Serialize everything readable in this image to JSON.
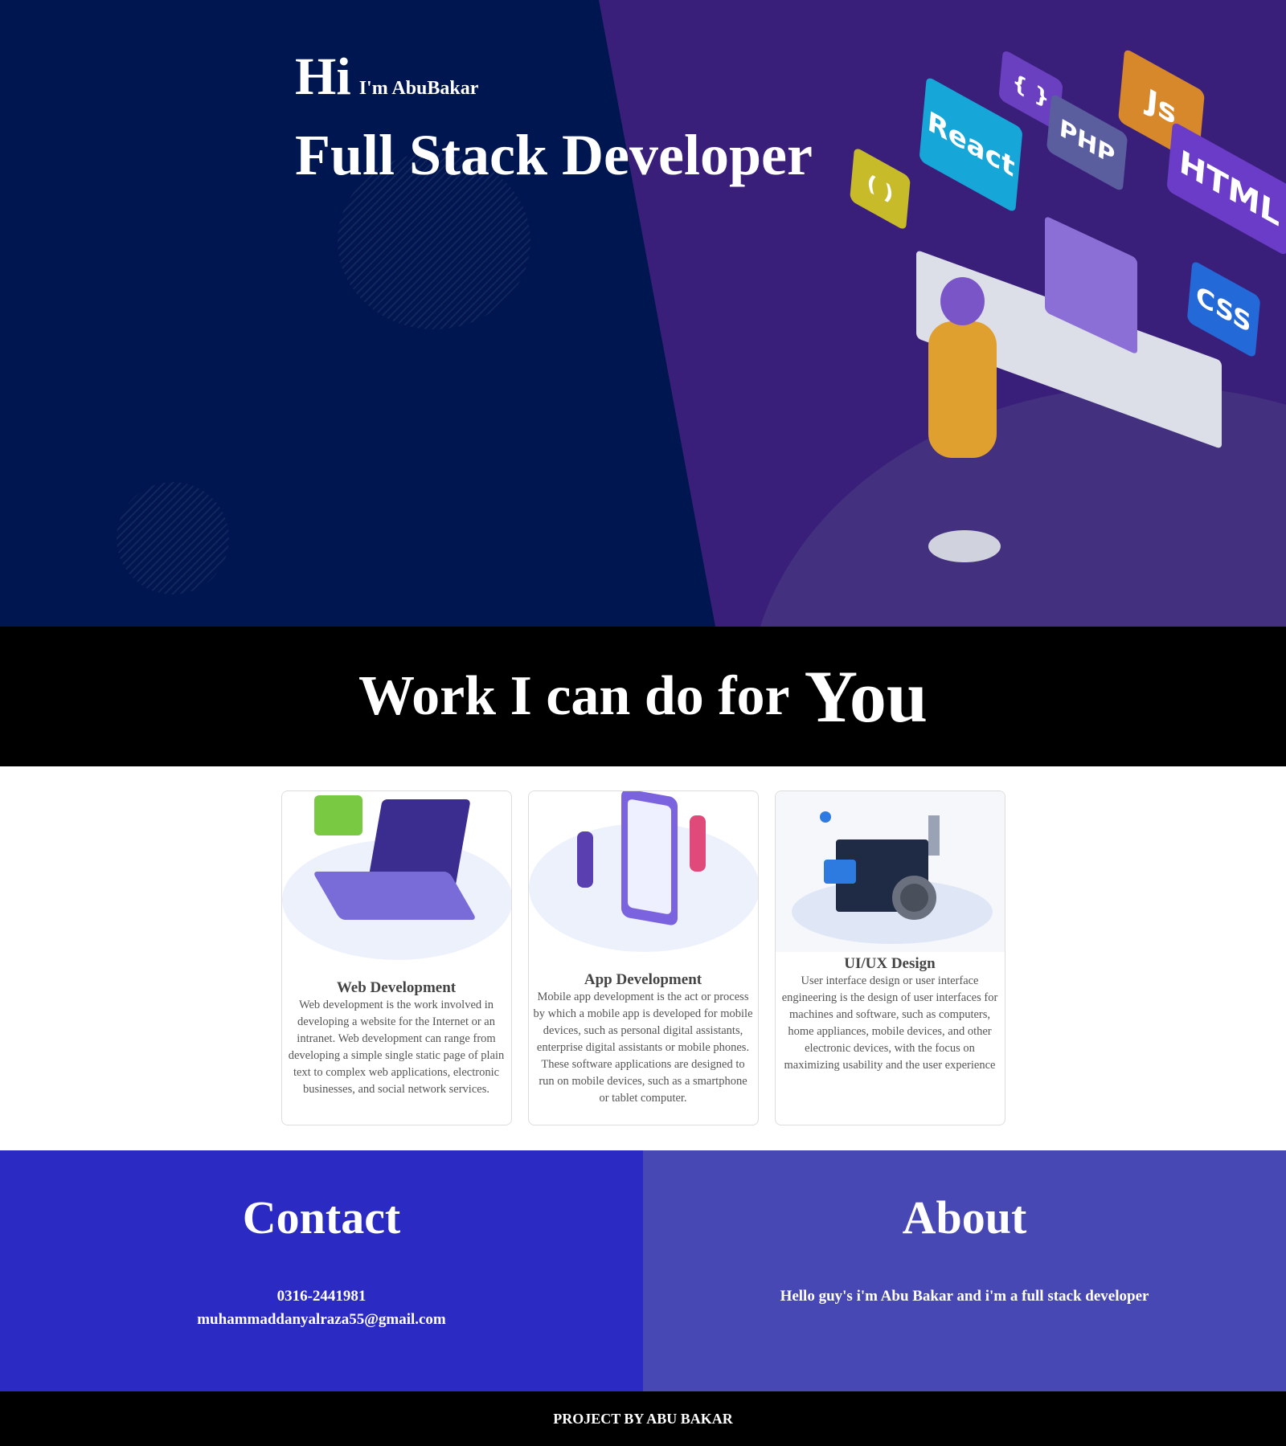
{
  "hero": {
    "greeting": "Hi",
    "name": "I'm AbuBakar",
    "role": "Full Stack Developer",
    "tags": [
      "{ }",
      "PHP",
      "Js",
      "React",
      "HTML",
      "( )",
      "CSS"
    ]
  },
  "services": {
    "title": "Work I can do for",
    "title_emphasis": "You",
    "cards": [
      {
        "title": "Web Development",
        "text": "Web development is the work involved in developing a website for the Internet or an intranet. Web development can range from developing a simple single static page of plain text to complex web applications, electronic businesses, and social network services."
      },
      {
        "title": "App Development",
        "text": "Mobile app development is the act or process by which a mobile app is developed for mobile devices, such as personal digital assistants, enterprise digital assistants or mobile phones. These software applications are designed to run on mobile devices, such as a smartphone or tablet computer."
      },
      {
        "title": "UI/UX Design",
        "text": "User interface design or user interface engineering is the design of user interfaces for machines and software, such as computers, home appliances, mobile devices, and other electronic devices, with the focus on maximizing usability and the user experience"
      }
    ]
  },
  "contact": {
    "title": "Contact",
    "phone": "0316-2441981",
    "email": "muhammaddanyalraza55@gmail.com"
  },
  "about": {
    "title": "About",
    "text": "Hello guy's i'm Abu Bakar and i'm a full stack developer"
  },
  "footer": {
    "text": "PROJECT BY ABU BAKAR"
  },
  "colors": {
    "hero_left": "#001650",
    "hero_right": "#3a1f7a",
    "contact_bg": "#2b2ac2",
    "about_bg": "#4848b4"
  }
}
